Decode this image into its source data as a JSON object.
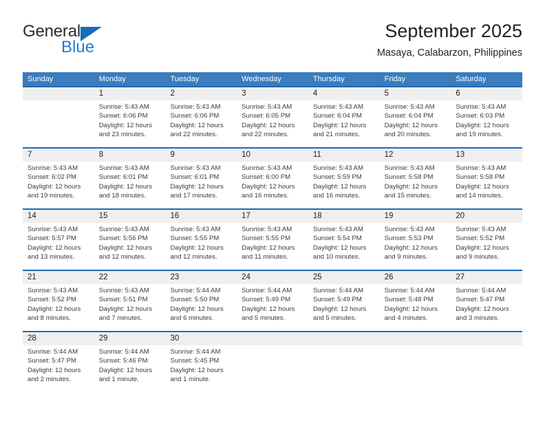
{
  "brand": {
    "name_top": "General",
    "name_bottom": "Blue",
    "triangle_color": "#1a6cb5",
    "blue_color": "#1a7fd4"
  },
  "header": {
    "title": "September 2025",
    "subtitle": "Masaya, Calabarzon, Philippines"
  },
  "theme": {
    "header_bg": "#3a7cbe",
    "row_divider": "#1a6cb5",
    "daynum_bg": "#efefef",
    "text": "#3b3b3b"
  },
  "weekdays": [
    "Sunday",
    "Monday",
    "Tuesday",
    "Wednesday",
    "Thursday",
    "Friday",
    "Saturday"
  ],
  "weeks": [
    [
      {
        "day": "",
        "sunrise": "",
        "sunset": "",
        "daylight1": "",
        "daylight2": ""
      },
      {
        "day": "1",
        "sunrise": "Sunrise: 5:43 AM",
        "sunset": "Sunset: 6:06 PM",
        "daylight1": "Daylight: 12 hours",
        "daylight2": "and 23 minutes."
      },
      {
        "day": "2",
        "sunrise": "Sunrise: 5:43 AM",
        "sunset": "Sunset: 6:06 PM",
        "daylight1": "Daylight: 12 hours",
        "daylight2": "and 22 minutes."
      },
      {
        "day": "3",
        "sunrise": "Sunrise: 5:43 AM",
        "sunset": "Sunset: 6:05 PM",
        "daylight1": "Daylight: 12 hours",
        "daylight2": "and 22 minutes."
      },
      {
        "day": "4",
        "sunrise": "Sunrise: 5:43 AM",
        "sunset": "Sunset: 6:04 PM",
        "daylight1": "Daylight: 12 hours",
        "daylight2": "and 21 minutes."
      },
      {
        "day": "5",
        "sunrise": "Sunrise: 5:43 AM",
        "sunset": "Sunset: 6:04 PM",
        "daylight1": "Daylight: 12 hours",
        "daylight2": "and 20 minutes."
      },
      {
        "day": "6",
        "sunrise": "Sunrise: 5:43 AM",
        "sunset": "Sunset: 6:03 PM",
        "daylight1": "Daylight: 12 hours",
        "daylight2": "and 19 minutes."
      }
    ],
    [
      {
        "day": "7",
        "sunrise": "Sunrise: 5:43 AM",
        "sunset": "Sunset: 6:02 PM",
        "daylight1": "Daylight: 12 hours",
        "daylight2": "and 19 minutes."
      },
      {
        "day": "8",
        "sunrise": "Sunrise: 5:43 AM",
        "sunset": "Sunset: 6:01 PM",
        "daylight1": "Daylight: 12 hours",
        "daylight2": "and 18 minutes."
      },
      {
        "day": "9",
        "sunrise": "Sunrise: 5:43 AM",
        "sunset": "Sunset: 6:01 PM",
        "daylight1": "Daylight: 12 hours",
        "daylight2": "and 17 minutes."
      },
      {
        "day": "10",
        "sunrise": "Sunrise: 5:43 AM",
        "sunset": "Sunset: 6:00 PM",
        "daylight1": "Daylight: 12 hours",
        "daylight2": "and 16 minutes."
      },
      {
        "day": "11",
        "sunrise": "Sunrise: 5:43 AM",
        "sunset": "Sunset: 5:59 PM",
        "daylight1": "Daylight: 12 hours",
        "daylight2": "and 16 minutes."
      },
      {
        "day": "12",
        "sunrise": "Sunrise: 5:43 AM",
        "sunset": "Sunset: 5:58 PM",
        "daylight1": "Daylight: 12 hours",
        "daylight2": "and 15 minutes."
      },
      {
        "day": "13",
        "sunrise": "Sunrise: 5:43 AM",
        "sunset": "Sunset: 5:58 PM",
        "daylight1": "Daylight: 12 hours",
        "daylight2": "and 14 minutes."
      }
    ],
    [
      {
        "day": "14",
        "sunrise": "Sunrise: 5:43 AM",
        "sunset": "Sunset: 5:57 PM",
        "daylight1": "Daylight: 12 hours",
        "daylight2": "and 13 minutes."
      },
      {
        "day": "15",
        "sunrise": "Sunrise: 5:43 AM",
        "sunset": "Sunset: 5:56 PM",
        "daylight1": "Daylight: 12 hours",
        "daylight2": "and 12 minutes."
      },
      {
        "day": "16",
        "sunrise": "Sunrise: 5:43 AM",
        "sunset": "Sunset: 5:55 PM",
        "daylight1": "Daylight: 12 hours",
        "daylight2": "and 12 minutes."
      },
      {
        "day": "17",
        "sunrise": "Sunrise: 5:43 AM",
        "sunset": "Sunset: 5:55 PM",
        "daylight1": "Daylight: 12 hours",
        "daylight2": "and 11 minutes."
      },
      {
        "day": "18",
        "sunrise": "Sunrise: 5:43 AM",
        "sunset": "Sunset: 5:54 PM",
        "daylight1": "Daylight: 12 hours",
        "daylight2": "and 10 minutes."
      },
      {
        "day": "19",
        "sunrise": "Sunrise: 5:43 AM",
        "sunset": "Sunset: 5:53 PM",
        "daylight1": "Daylight: 12 hours",
        "daylight2": "and 9 minutes."
      },
      {
        "day": "20",
        "sunrise": "Sunrise: 5:43 AM",
        "sunset": "Sunset: 5:52 PM",
        "daylight1": "Daylight: 12 hours",
        "daylight2": "and 9 minutes."
      }
    ],
    [
      {
        "day": "21",
        "sunrise": "Sunrise: 5:43 AM",
        "sunset": "Sunset: 5:52 PM",
        "daylight1": "Daylight: 12 hours",
        "daylight2": "and 8 minutes."
      },
      {
        "day": "22",
        "sunrise": "Sunrise: 5:43 AM",
        "sunset": "Sunset: 5:51 PM",
        "daylight1": "Daylight: 12 hours",
        "daylight2": "and 7 minutes."
      },
      {
        "day": "23",
        "sunrise": "Sunrise: 5:44 AM",
        "sunset": "Sunset: 5:50 PM",
        "daylight1": "Daylight: 12 hours",
        "daylight2": "and 6 minutes."
      },
      {
        "day": "24",
        "sunrise": "Sunrise: 5:44 AM",
        "sunset": "Sunset: 5:49 PM",
        "daylight1": "Daylight: 12 hours",
        "daylight2": "and 5 minutes."
      },
      {
        "day": "25",
        "sunrise": "Sunrise: 5:44 AM",
        "sunset": "Sunset: 5:49 PM",
        "daylight1": "Daylight: 12 hours",
        "daylight2": "and 5 minutes."
      },
      {
        "day": "26",
        "sunrise": "Sunrise: 5:44 AM",
        "sunset": "Sunset: 5:48 PM",
        "daylight1": "Daylight: 12 hours",
        "daylight2": "and 4 minutes."
      },
      {
        "day": "27",
        "sunrise": "Sunrise: 5:44 AM",
        "sunset": "Sunset: 5:47 PM",
        "daylight1": "Daylight: 12 hours",
        "daylight2": "and 3 minutes."
      }
    ],
    [
      {
        "day": "28",
        "sunrise": "Sunrise: 5:44 AM",
        "sunset": "Sunset: 5:47 PM",
        "daylight1": "Daylight: 12 hours",
        "daylight2": "and 2 minutes."
      },
      {
        "day": "29",
        "sunrise": "Sunrise: 5:44 AM",
        "sunset": "Sunset: 5:46 PM",
        "daylight1": "Daylight: 12 hours",
        "daylight2": "and 1 minute."
      },
      {
        "day": "30",
        "sunrise": "Sunrise: 5:44 AM",
        "sunset": "Sunset: 5:45 PM",
        "daylight1": "Daylight: 12 hours",
        "daylight2": "and 1 minute."
      },
      {
        "day": "",
        "sunrise": "",
        "sunset": "",
        "daylight1": "",
        "daylight2": ""
      },
      {
        "day": "",
        "sunrise": "",
        "sunset": "",
        "daylight1": "",
        "daylight2": ""
      },
      {
        "day": "",
        "sunrise": "",
        "sunset": "",
        "daylight1": "",
        "daylight2": ""
      },
      {
        "day": "",
        "sunrise": "",
        "sunset": "",
        "daylight1": "",
        "daylight2": ""
      }
    ]
  ]
}
